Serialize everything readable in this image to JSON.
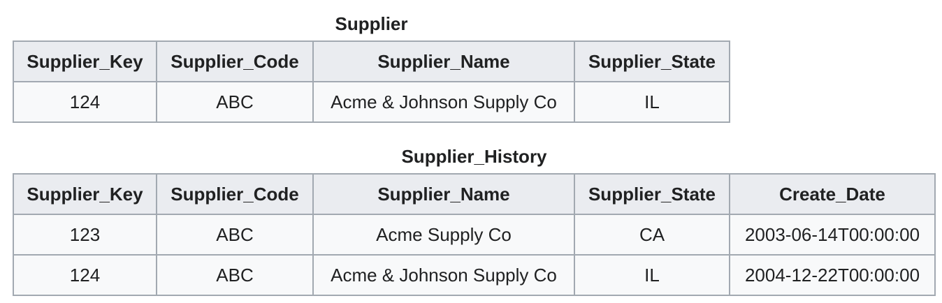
{
  "tables": [
    {
      "caption": "Supplier",
      "headers": [
        "Supplier_Key",
        "Supplier_Code",
        "Supplier_Name",
        "Supplier_State"
      ],
      "rows": [
        [
          "124",
          "ABC",
          "Acme & Johnson Supply Co",
          "IL"
        ]
      ]
    },
    {
      "caption": "Supplier_History",
      "headers": [
        "Supplier_Key",
        "Supplier_Code",
        "Supplier_Name",
        "Supplier_State",
        "Create_Date"
      ],
      "rows": [
        [
          "123",
          "ABC",
          "Acme Supply Co",
          "CA",
          "2003-06-14T00:00:00"
        ],
        [
          "124",
          "ABC",
          "Acme & Johnson Supply Co",
          "IL",
          "2004-12-22T00:00:00"
        ]
      ]
    }
  ]
}
